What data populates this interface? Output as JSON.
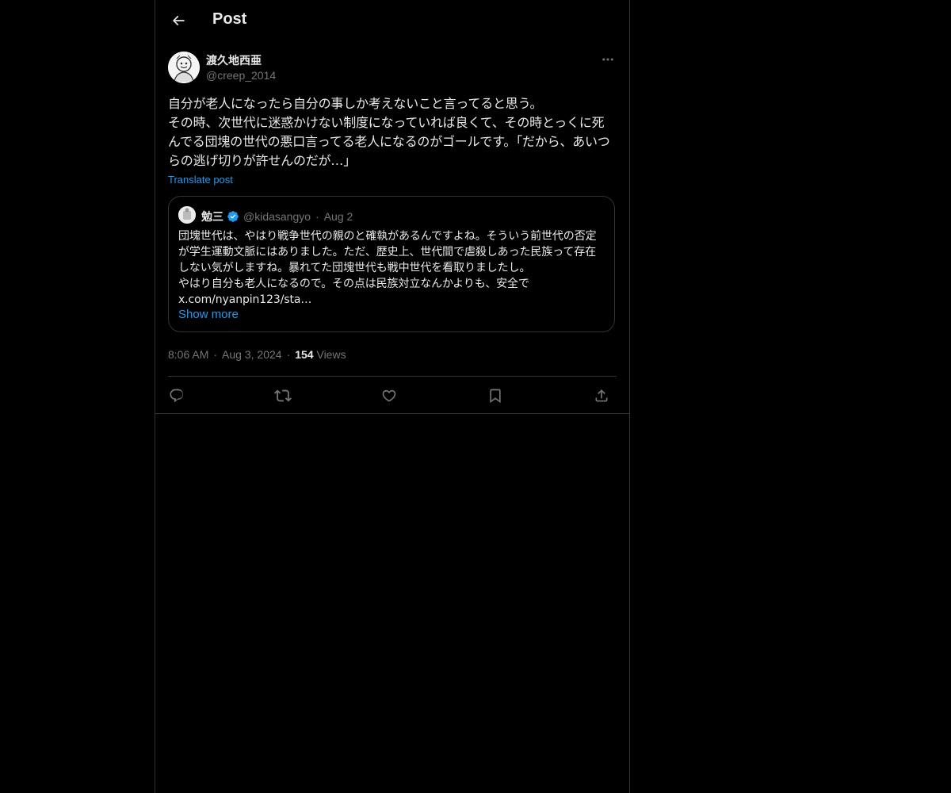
{
  "header": {
    "title": "Post"
  },
  "post": {
    "author_name": "渡久地西亜",
    "author_handle": "@creep_2014",
    "text": "自分が老人になったら自分の事しか考えないこと言ってると思う。\nその時、次世代に迷惑かけない制度になっていれば良くて、その時とっくに死んでる団塊の世代の悪口言ってる老人になるのがゴールです。「だから、あいつらの逃げ切りが許せんのだが…」",
    "translate_label": "Translate post",
    "time": "8:06 AM",
    "date": "Aug 3, 2024",
    "views_count": "154",
    "views_label": "Views"
  },
  "quote": {
    "name": "勉三",
    "handle": "@kidasangyo",
    "date": "Aug 2",
    "text": "団塊世代は、やはり戦争世代の親のと確執があるんですよね。そういう前世代の否定が学生運動文脈にはありました。ただ、歴史上、世代間で虐殺しあった民族って存在しない気がしますね。暴れてた団塊世代も戦中世代を看取りましたし。\nやはり自分も老人になるので。その点は民族対立なんかよりも、安全で\nx.com/nyanpin123/sta…",
    "show_more": "Show more"
  },
  "actions": [
    {
      "icon": "reply-icon"
    },
    {
      "icon": "repost-icon"
    },
    {
      "icon": "like-icon"
    },
    {
      "icon": "bookmark-icon"
    },
    {
      "icon": "share-icon"
    }
  ],
  "colors": {
    "background": "#000000",
    "text": "#e7e9ea",
    "secondary": "#71767b",
    "accent": "#1d9bf0",
    "border": "#2f3336"
  }
}
